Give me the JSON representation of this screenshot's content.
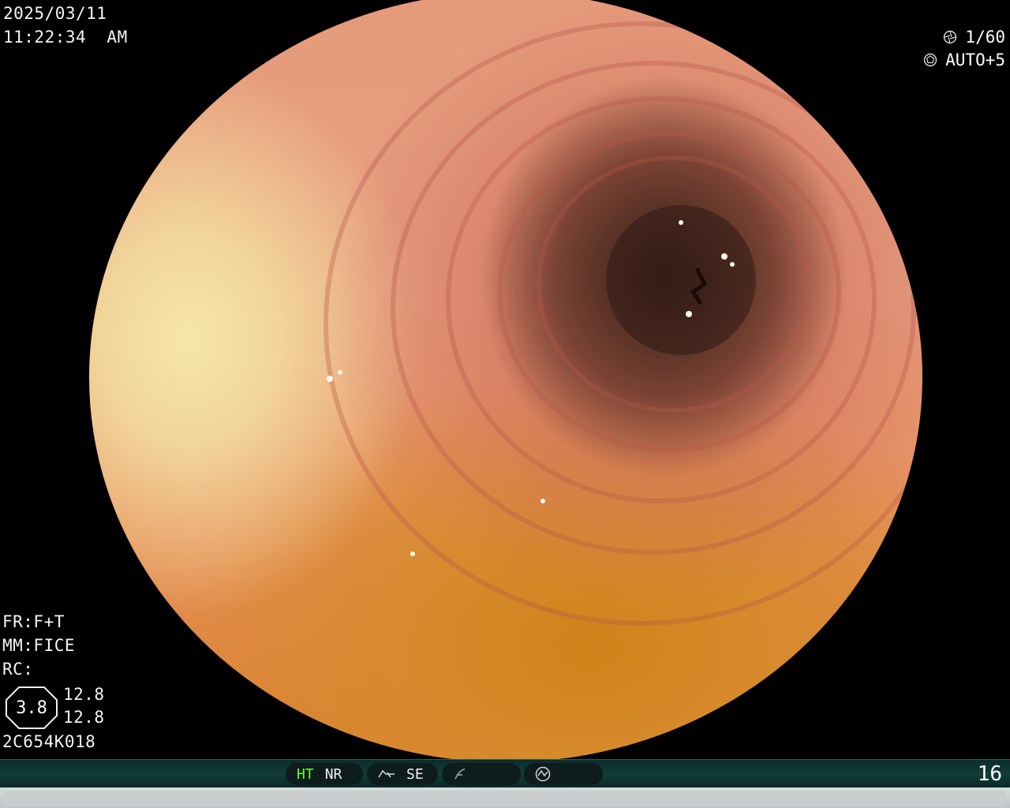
{
  "overlay": {
    "date": "2025/03/11",
    "time": "11:22:34  AM",
    "shutter": "1/60",
    "iris": "AUTO+5",
    "fr": "FR:F+T",
    "mm": "MM:FICE",
    "rc": "RC:",
    "zoom": "3.8",
    "value_a": "12.8",
    "value_b": "12.8",
    "scope_id": "2C654K018"
  },
  "status_bar": {
    "ht": "HT",
    "nr": "NR",
    "se": "SE",
    "frame": "16"
  },
  "icons": {
    "shutter": "shutter-icon",
    "iris": "iris-icon",
    "edge": "edge-enhance-icon",
    "structure": "structure-icon",
    "color": "color-mode-icon"
  },
  "colors": {
    "ht_label": "#5cff3a",
    "status_bar": "#123c39"
  }
}
